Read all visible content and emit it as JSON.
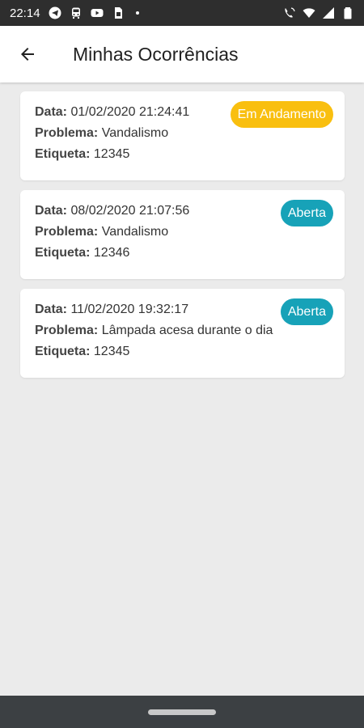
{
  "status_bar": {
    "time": "22:14",
    "left_icons": [
      "telegram-icon",
      "train-icon",
      "youtube-icon",
      "sim-card-icon"
    ],
    "right_icons": [
      "wifi-call-icon",
      "4g-icon",
      "wifi-icon",
      "signal-icon",
      "battery-icon"
    ]
  },
  "app_bar": {
    "title": "Minhas Ocorrências",
    "back_icon": "arrow-back-icon"
  },
  "labels": {
    "data": "Data:",
    "problema": "Problema:",
    "etiqueta": "Etiqueta:"
  },
  "occurrences": [
    {
      "data": "01/02/2020 21:24:41",
      "problema": "Vandalismo",
      "etiqueta": "12345",
      "status": "Em Andamento",
      "status_color": "#f9bf0f"
    },
    {
      "data": "08/02/2020 21:07:56",
      "problema": "Vandalismo",
      "etiqueta": "12346",
      "status": "Aberta",
      "status_color": "#17a2b8"
    },
    {
      "data": "11/02/2020 19:32:17",
      "problema": "Lâmpada acesa durante o dia",
      "etiqueta": "12345",
      "status": "Aberta",
      "status_color": "#17a2b8"
    }
  ]
}
